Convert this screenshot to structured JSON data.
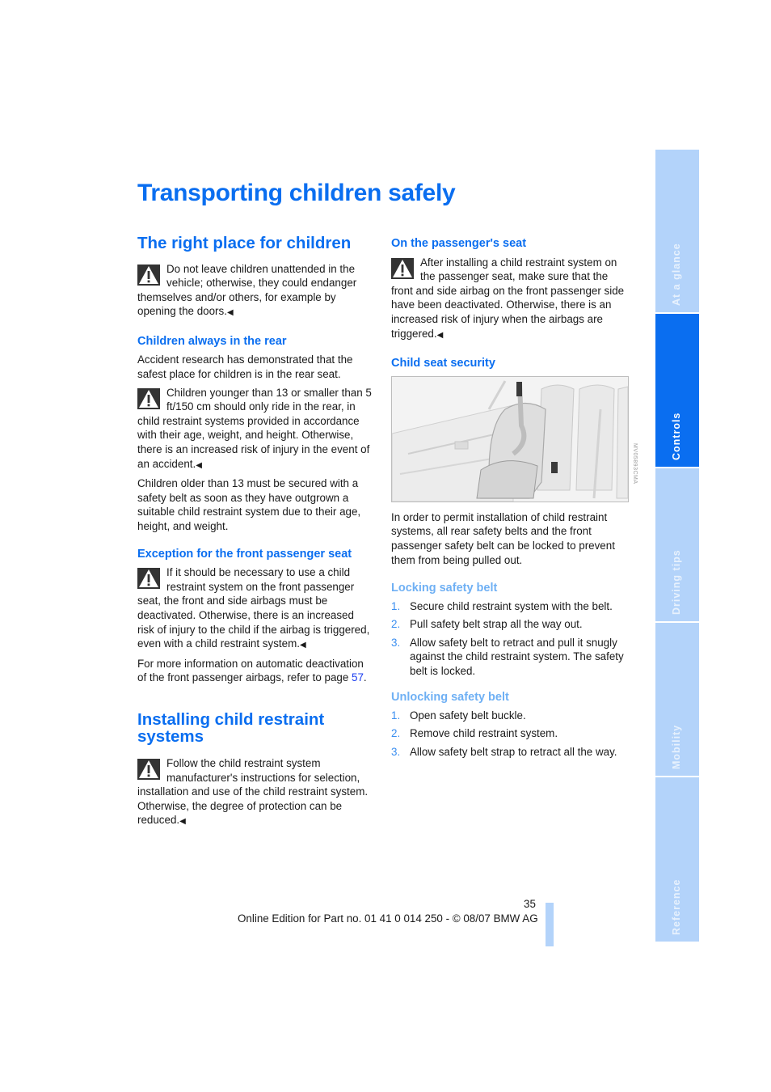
{
  "page_title": "Transporting children safely",
  "left_column": {
    "section1_title": "The right place for children",
    "warning1": "Do not leave children unattended in the vehicle; otherwise, they could endanger themselves and/or others, for example by opening the doors.",
    "sub1_title": "Children always in the rear",
    "sub1_para": "Accident research has demonstrated that the safest place for children is in the rear seat.",
    "warning2": "Children younger than 13 or smaller than 5 ft/150 cm should only ride in the rear, in child restraint systems provided in accordance with their age, weight, and height. Otherwise, there is an increased risk of injury in the event of an accident.",
    "sub1_para2": "Children older than 13 must be secured with a safety belt as soon as they have outgrown a suitable child restraint system due to their age, height, and weight.",
    "sub2_title": "Exception for the front passenger seat",
    "warning3": "If it should be necessary to use a child restraint system on the front passenger seat, the front and side airbags must be deactivated. Otherwise, there is an increased risk of injury to the child if the airbag is triggered, even with a child restraint system.",
    "sub2_para_prefix": "For more information on automatic deactivation of the front passenger airbags, refer to page ",
    "sub2_page_link": "57",
    "sub2_para_suffix": ".",
    "section2_title": "Installing child restraint systems",
    "warning4": "Follow the child restraint system manufacturer's instructions for selection, installation and use of the child restraint system. Otherwise, the degree of protection can be reduced."
  },
  "right_column": {
    "sub3_title": "On the passenger's seat",
    "warning5": "After installing a child restraint system on the passenger seat, make sure that the front and side airbag on the front passenger side have been deactivated. Otherwise, there is an increased risk of injury when the airbags are triggered.",
    "sub4_title": "Child seat security",
    "figure_code": "MV05893CMA",
    "sub4_para": "In order to permit installation of child restraint systems, all rear safety belts and the front passenger safety belt can be locked to prevent them from being pulled out.",
    "locking_title": "Locking safety belt",
    "locking_steps": [
      {
        "num": "1.",
        "text": "Secure child restraint system with the belt."
      },
      {
        "num": "2.",
        "text": "Pull safety belt strap all the way out."
      },
      {
        "num": "3.",
        "text": "Allow safety belt to retract and pull it snugly against the child restraint system. The safety belt is locked."
      }
    ],
    "unlocking_title": "Unlocking safety belt",
    "unlocking_steps": [
      {
        "num": "1.",
        "text": "Open safety belt buckle."
      },
      {
        "num": "2.",
        "text": "Remove child restraint system."
      },
      {
        "num": "3.",
        "text": "Allow safety belt strap to retract all the way."
      }
    ]
  },
  "end_mark": "◀",
  "side_tabs": [
    {
      "label": "At a glance",
      "active": false
    },
    {
      "label": "Controls",
      "active": true
    },
    {
      "label": "Driving tips",
      "active": false
    },
    {
      "label": "Mobility",
      "active": false
    },
    {
      "label": "Reference",
      "active": false
    }
  ],
  "footer": {
    "page_number": "35",
    "text": "Online Edition for Part no. 01 41 0 014 250 - © 08/07 BMW AG"
  },
  "colors": {
    "accent": "#0a6ef0",
    "accent_light": "#6fb0f4",
    "tab_inactive": "#b3d3fa",
    "link": "#1a3cf0"
  }
}
